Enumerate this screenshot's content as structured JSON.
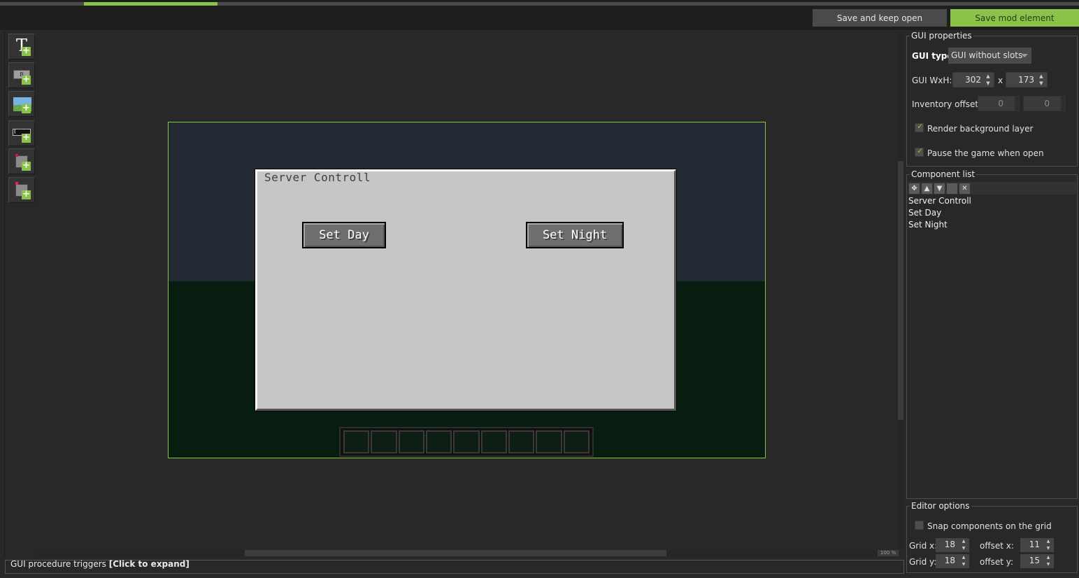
{
  "toolbar": {
    "save_keep_open": "Save and keep open",
    "save_mod_element": "Save mod element"
  },
  "tools": [
    {
      "name": "add-label-tool",
      "icon": "text-label-icon",
      "glyph": "T"
    },
    {
      "name": "add-button-tool",
      "icon": "button-icon",
      "glyph": "B"
    },
    {
      "name": "add-image-tool",
      "icon": "image-icon",
      "glyph": ""
    },
    {
      "name": "add-textfield-tool",
      "icon": "textfield-icon",
      "glyph": "I"
    },
    {
      "name": "add-checkbox-tool",
      "icon": "checkbox-icon",
      "glyph": ""
    },
    {
      "name": "add-slot-tool",
      "icon": "slot-icon",
      "glyph": ""
    }
  ],
  "canvas": {
    "gui_title": "Server Controll",
    "buttons": [
      "Set Day",
      "Set Night"
    ],
    "hotbar_slots": 9,
    "zoom": "100 %",
    "colors": {
      "frame": "#8bc34a",
      "sky": "#242a33",
      "ground": "#071d10",
      "panel": "#c6c6c6"
    }
  },
  "triggers": {
    "label": "GUI procedure triggers ",
    "expand": "[Click to expand]"
  },
  "gui_properties": {
    "title": "GUI properties",
    "gui_type_label": "GUI type:",
    "gui_type_value": "GUI without slots",
    "wxh_label": "GUI WxH:",
    "width": "302",
    "x_sep": "x",
    "height": "173",
    "inventory_offset_label": "Inventory offset:",
    "inv_offset_x": "0",
    "inv_offset_y": "0",
    "render_bg_label": "Render background layer",
    "render_bg_checked": true,
    "pause_label": "Pause the game when open",
    "pause_checked": true
  },
  "component_list": {
    "title": "Component list",
    "items": [
      "Server Controll",
      "Set Day",
      "Set Night"
    ]
  },
  "editor_options": {
    "title": "Editor options",
    "snap_label": "Snap components on the grid",
    "snap_checked": false,
    "grid_x_label": "Grid x:",
    "grid_x": "18",
    "offset_x_label": "offset x:",
    "offset_x": "11",
    "grid_y_label": "Grid y:",
    "grid_y": "18",
    "offset_y_label": "offset y:",
    "offset_y": "15"
  },
  "accent_color": "#8bc34a"
}
